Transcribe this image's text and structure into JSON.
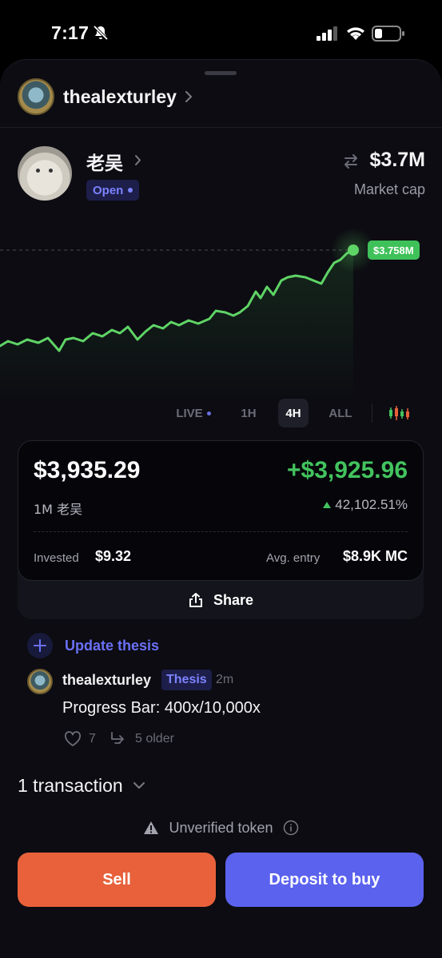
{
  "status_bar": {
    "time": "7:17"
  },
  "creator": {
    "username": "thealexturley"
  },
  "token": {
    "name": "老吴",
    "status": "Open",
    "market_cap": "$3.7M",
    "market_cap_label": "Market cap"
  },
  "chart": {
    "current_price_label": "$3.758M",
    "line_color": "#5fd466",
    "timeframes": [
      "LIVE",
      "1H",
      "4H",
      "ALL"
    ],
    "selected_timeframe": "4H"
  },
  "position": {
    "value": "$3,935.29",
    "pnl": "+$3,925.96",
    "quantity": "1M 老吴",
    "pnl_percent": "42,102.51%",
    "invested_label": "Invested",
    "invested_value": "$9.32",
    "avg_entry_label": "Avg. entry",
    "avg_entry_value": "$8.9K MC",
    "share_label": "Share"
  },
  "thesis": {
    "update_label": "Update thesis",
    "post": {
      "username": "thealexturley",
      "badge": "Thesis",
      "time": "2m",
      "body": "Progress Bar: 400x/10,000x",
      "likes": "7",
      "older": "5 older"
    }
  },
  "transactions": {
    "label": "1 transaction"
  },
  "warning": {
    "label": "Unverified token"
  },
  "actions": {
    "sell_label": "Sell",
    "deposit_label": "Deposit to buy"
  },
  "colors": {
    "accent": "#5b62ee",
    "sell": "#e8613a",
    "positive": "#43c35e",
    "background": "#0c0c12"
  }
}
